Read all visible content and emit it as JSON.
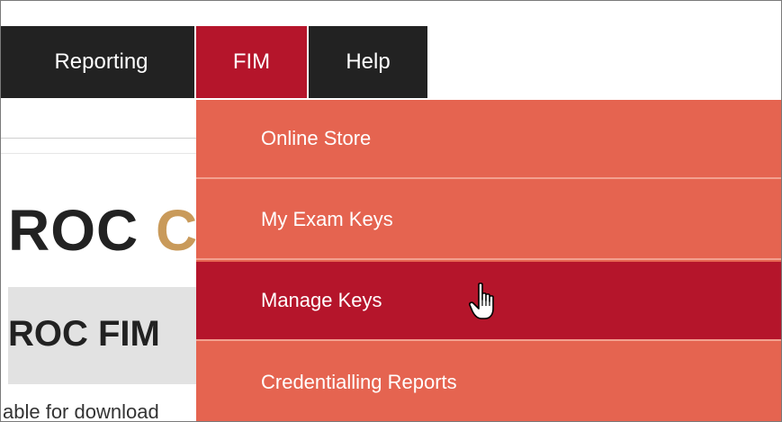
{
  "nav": {
    "items": [
      {
        "label": "Reporting"
      },
      {
        "label": "FIM"
      },
      {
        "label": "Help"
      }
    ]
  },
  "page": {
    "title_visible": "ROC",
    "title_partial": "C",
    "subheader_visible": "ROC FIM",
    "body_text_visible": "able for download"
  },
  "dropdown": {
    "items": [
      {
        "label": "Online Store",
        "active": false
      },
      {
        "label": "My Exam Keys",
        "active": false
      },
      {
        "label": "Manage Keys",
        "active": true
      },
      {
        "label": "Credentialling Reports",
        "active": false
      }
    ]
  },
  "colors": {
    "nav_dark": "#222222",
    "nav_active": "#b5152b",
    "dropdown_bg": "#e56450",
    "dropdown_active": "#b5152b"
  },
  "cursor": {
    "icon": "hand-pointer-icon"
  }
}
